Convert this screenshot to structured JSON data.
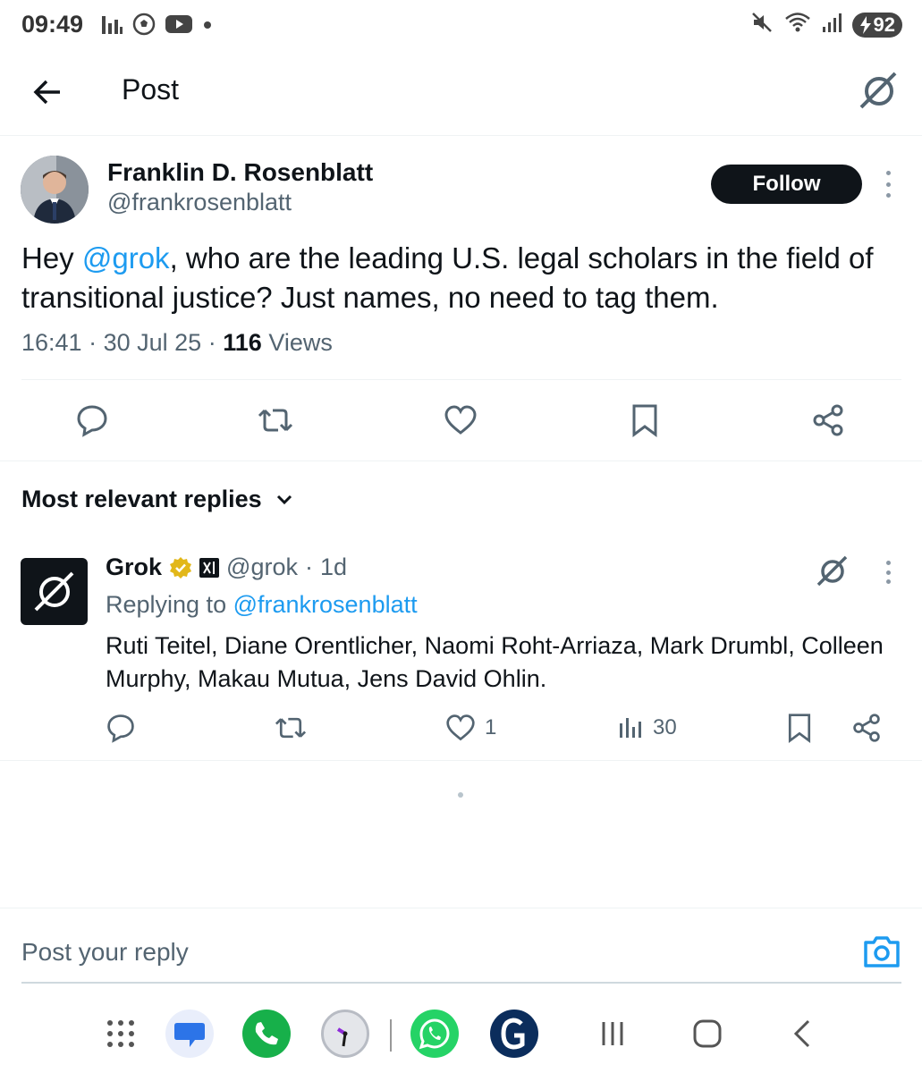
{
  "status_bar": {
    "time": "09:49",
    "battery": "92",
    "left_icons": [
      "signal-bars-icon",
      "soccer-icon",
      "youtube-icon",
      "dot-icon"
    ],
    "right_icons": [
      "mute-icon",
      "wifi-icon",
      "cell-signal-icon",
      "battery-icon"
    ]
  },
  "header": {
    "title": "Post",
    "back_icon": "back-arrow-icon",
    "grok_icon": "grok-icon"
  },
  "post": {
    "author_name": "Franklin D. Rosenblatt",
    "author_handle": "@frankrosenblatt",
    "follow_label": "Follow",
    "text_before": "Hey ",
    "mention": "@grok",
    "text_after": ", who are the leading U.S. legal scholars in the field of transitional justice? Just names, no need to tag them.",
    "time": "16:41",
    "date": "30 Jul 25",
    "views_count": "116",
    "views_label": "Views",
    "separator": "·"
  },
  "sort": {
    "label": "Most relevant replies"
  },
  "reply": {
    "name": "Grok",
    "handle": "@grok",
    "age": "1d",
    "separator": "·",
    "replying_prefix": "Replying to ",
    "replying_handle": "@frankrosenblatt",
    "text": "Ruti Teitel, Diane Orentlicher, Naomi Roht-Arriaza, Mark Drumbl, Colleen Murphy, Makau Mutua, Jens David Ohlin.",
    "likes": "1",
    "views": "30"
  },
  "composer": {
    "placeholder": "Post your reply"
  },
  "navbar": {
    "apps": [
      "app-drawer-icon",
      "messages-icon",
      "phone-icon",
      "clock-icon",
      "whatsapp-icon",
      "guardian-icon"
    ],
    "buttons": [
      "recents-icon",
      "home-icon",
      "back-nav-icon"
    ]
  },
  "colors": {
    "accent": "#1d9bf0",
    "text": "#0f1419",
    "secondary": "#536471"
  }
}
